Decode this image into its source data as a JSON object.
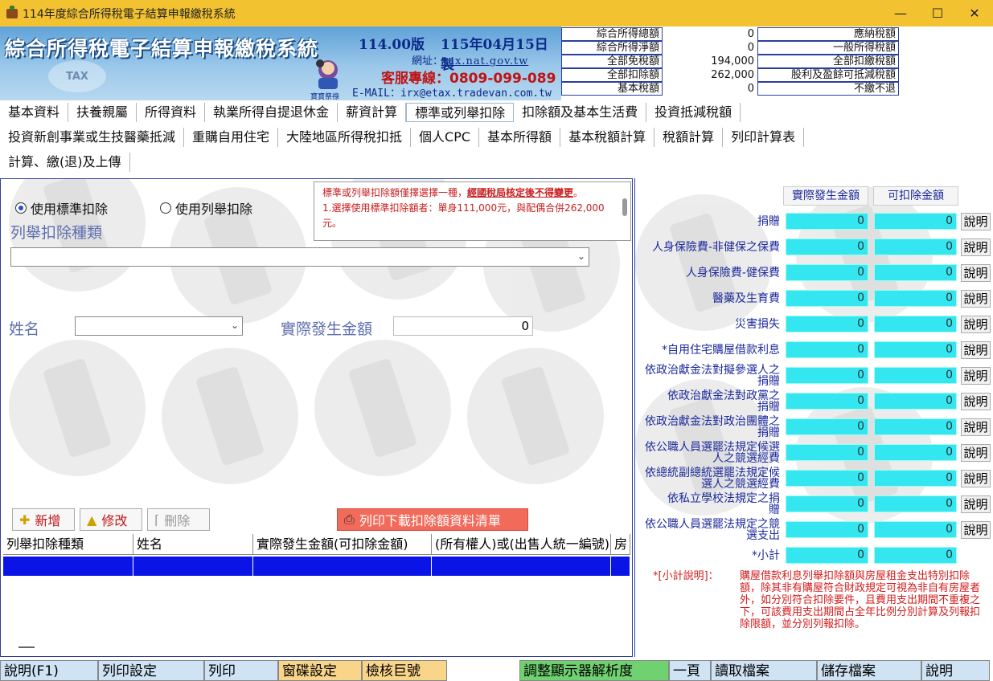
{
  "window": {
    "title": "114年度綜合所得稅電子結算申報繳稅系統"
  },
  "banner": {
    "logo_text": "綜合所得稅電子結算申報繳稅系統",
    "tax_mark": "TAX",
    "version": "114.00版",
    "date": "115年04月15日製",
    "url_label": "網址：",
    "url": "tax.nat.gov.tw",
    "hotline": "客服專線：0809-099-089",
    "email_label": "E-MAIL：",
    "email": "irx@etax.tradevan.com.tw",
    "mascot_label": "寶寶祭祿"
  },
  "summary": {
    "left": [
      {
        "label": "綜合所得總額",
        "value": "0"
      },
      {
        "label": "綜合所得淨額",
        "value": "0"
      },
      {
        "label": "全部免稅額",
        "value": "194,000"
      },
      {
        "label": "全部扣除額",
        "value": "262,000"
      },
      {
        "label": "基本稅額",
        "value": "0"
      }
    ],
    "right": [
      {
        "label": "應納稅額"
      },
      {
        "label": "一般所得稅額"
      },
      {
        "label": "全部扣繳稅額"
      },
      {
        "label": "股利及盈餘可抵減稅額"
      },
      {
        "label": "不繳不退"
      }
    ]
  },
  "menu_row1": [
    "基本資料",
    "扶養親屬",
    "所得資料",
    "執業所得自提退休金",
    "薪資計算",
    "標準或列舉扣除",
    "扣除額及基本生活費",
    "投資抵減稅額"
  ],
  "menu_row2": [
    "投資新創事業或生技醫藥抵減",
    "重購自用住宅",
    "大陸地區所得稅扣抵",
    "個人CPC",
    "基本所得額",
    "基本稅額計算",
    "稅額計算",
    "列印計算表"
  ],
  "menu_row3": [
    "計算、繳(退)及上傳"
  ],
  "left": {
    "radio_standard": "使用標準扣除",
    "radio_itemized": "使用列舉扣除",
    "notice_line1": "標準或列舉扣除額僅擇選擇一種，",
    "notice_line1_emph": "經國稅局核定後不得變更",
    "notice_line1_end": "。",
    "notice_line2": "1.選擇使用標準扣除額者：單身111,000元，與配偶合併262,000元。",
    "itemized_type_label": "列舉扣除種類",
    "name_label": "姓名",
    "amount_label": "實際發生金額",
    "amount_value": "0",
    "btn_add": "新增",
    "btn_edit": "修改",
    "btn_delete": "刪除",
    "btn_print_list": "列印下載扣除額資料清單",
    "grid_headers": [
      "列舉扣除種類",
      "姓名",
      "實際發生金額(可扣除金額)",
      "(所有權人)或(出售人統一編號)",
      "房"
    ]
  },
  "right": {
    "col_actual": "實際發生金額",
    "col_deductible": "可扣除金額",
    "explain": "說明",
    "rows": [
      {
        "label": "捐贈",
        "actual": "0",
        "deductible": "0"
      },
      {
        "label": "人身保險費-非健保之保費",
        "actual": "0",
        "deductible": "0"
      },
      {
        "label": "人身保險費-健保費",
        "actual": "0",
        "deductible": "0"
      },
      {
        "label": "醫藥及生育費",
        "actual": "0",
        "deductible": "0"
      },
      {
        "label": "災害損失",
        "actual": "0",
        "deductible": "0"
      },
      {
        "label": "*自用住宅購屋借款利息",
        "actual": "0",
        "deductible": "0"
      },
      {
        "label": "依政治獻金法對擬參選人之捐贈",
        "actual": "0",
        "deductible": "0"
      },
      {
        "label": "依政治獻金法對政黨之捐贈",
        "actual": "0",
        "deductible": "0"
      },
      {
        "label": "依政治獻金法對政治團體之捐贈",
        "actual": "0",
        "deductible": "0"
      },
      {
        "label": "依公職人員選罷法規定候選人之競選經費",
        "actual": "0",
        "deductible": "0"
      },
      {
        "label": "依總統副總統選罷法規定候選人之競選經費",
        "actual": "0",
        "deductible": "0"
      },
      {
        "label": "依私立學校法規定之捐贈",
        "actual": "0",
        "deductible": "0"
      },
      {
        "label": "依公職人員選罷法規定之競選支出",
        "actual": "0",
        "deductible": "0"
      }
    ],
    "subtotal_label": "*小計",
    "subtotal_actual": "0",
    "subtotal_deductible": "0",
    "footnote_label": "*[小計說明]：",
    "footnote": "購屋借款利息列舉扣除額與房屋租金支出特別扣除額，除其非有購屋符合財政規定可視為非自有房屋者外，如分別符合扣除要件，且費用支出期間不重複之下，可該費用支出期間占全年比例分別計算及列報扣除限額，並分別列報扣除。"
  },
  "bottom": [
    "說明(F1)",
    "列印設定",
    "列印",
    "窗碟設定",
    "檢核巨號",
    "調整顯示器解析度",
    "一頁",
    "讀取檔案",
    "儲存檔案",
    "說明"
  ]
}
